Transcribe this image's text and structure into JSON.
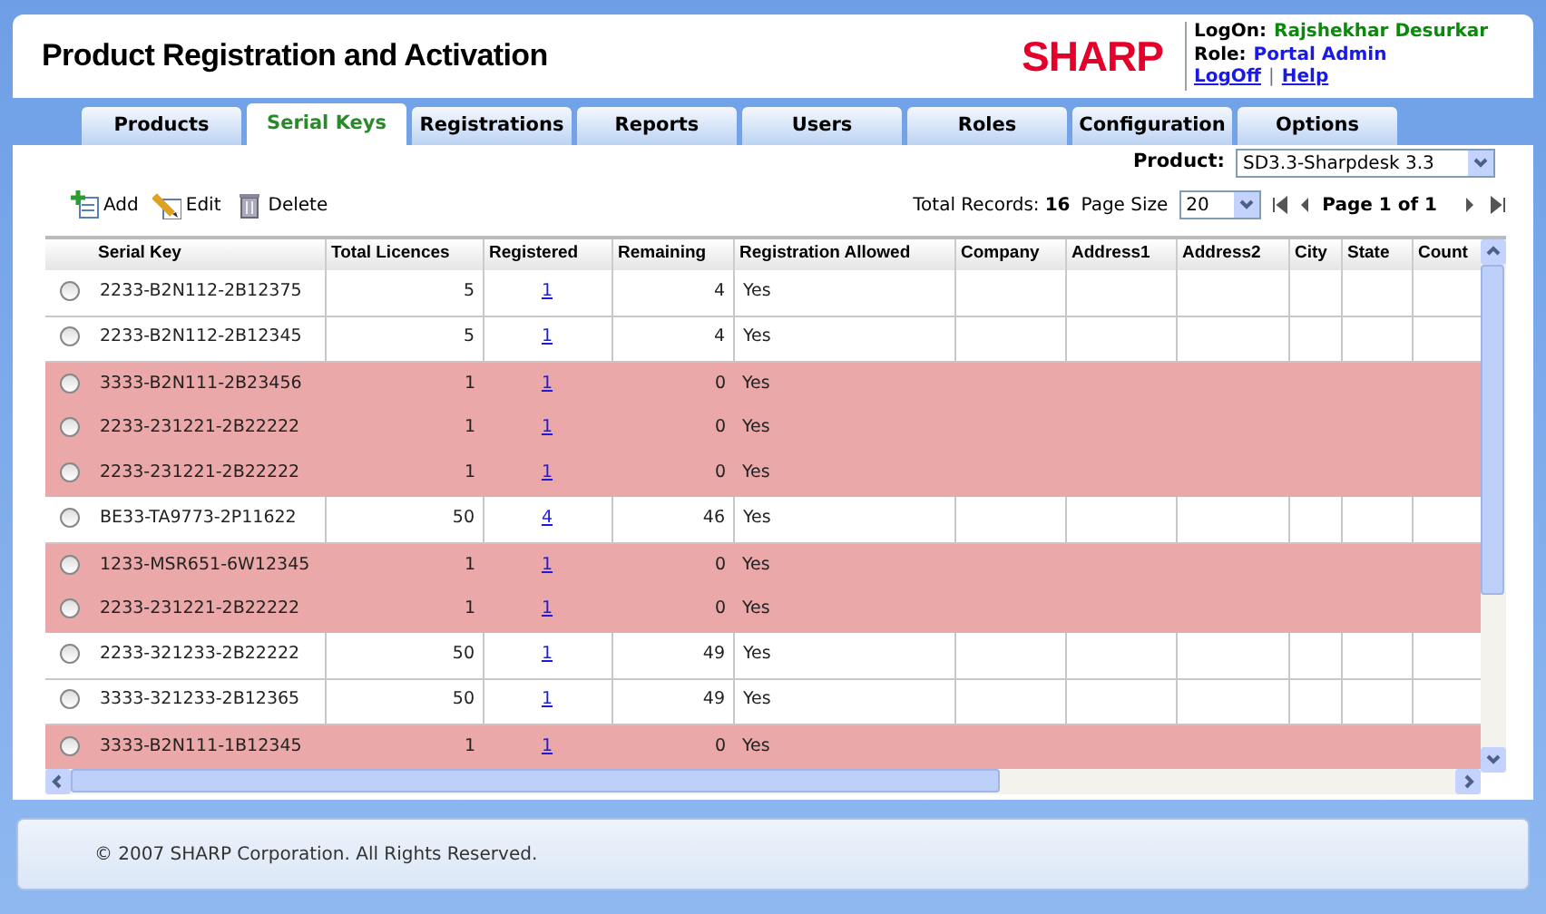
{
  "header": {
    "title": "Product Registration and Activation",
    "logo": "SHARP",
    "logon_label": "LogOn:",
    "logon_user": "Rajshekhar Desurkar",
    "role_label": "Role:",
    "role": "Portal Admin",
    "logoff": "LogOff",
    "separator": "|",
    "help": "Help"
  },
  "tabs": [
    {
      "label": "Products",
      "selected": false
    },
    {
      "label": "Serial Keys",
      "selected": true
    },
    {
      "label": "Registrations",
      "selected": false
    },
    {
      "label": "Reports",
      "selected": false
    },
    {
      "label": "Users",
      "selected": false
    },
    {
      "label": "Roles",
      "selected": false
    },
    {
      "label": "Configuration",
      "selected": false
    },
    {
      "label": "Options",
      "selected": false
    }
  ],
  "product": {
    "label": "Product:",
    "value": "SD3.3-Sharpdesk 3.3"
  },
  "toolbar": [
    {
      "kind": "add",
      "label": "Add"
    },
    {
      "kind": "edit",
      "label": "Edit"
    },
    {
      "kind": "delete",
      "label": "Delete"
    }
  ],
  "paging": {
    "total_label": "Total Records:",
    "total": "16",
    "page_size_label": "Page Size",
    "page_size": "20",
    "page_text": "Page",
    "page": "1",
    "of": "of",
    "pages": "1"
  },
  "table": {
    "columns": [
      "Serial Key",
      "Total Licences",
      "Registered",
      "Remaining",
      "Registration Allowed",
      "Company",
      "Address1",
      "Address2",
      "City",
      "State",
      "Count"
    ],
    "rows": [
      {
        "serial": "2233-B2N112-2B12375",
        "total": "5",
        "registered": "1",
        "remaining": "4",
        "allowed": "Yes",
        "highlighted": false,
        "selected": false
      },
      {
        "serial": "2233-B2N112-2B12345",
        "total": "5",
        "registered": "1",
        "remaining": "4",
        "allowed": "Yes",
        "highlighted": false,
        "selected": false
      },
      {
        "serial": "3333-B2N111-2B23456",
        "total": "1",
        "registered": "1",
        "remaining": "0",
        "allowed": "Yes",
        "highlighted": true,
        "selected": false
      },
      {
        "serial": "2233-231221-2B22222",
        "total": "1",
        "registered": "1",
        "remaining": "0",
        "allowed": "Yes",
        "highlighted": true,
        "selected": false
      },
      {
        "serial": "2233-231221-2B22222",
        "total": "1",
        "registered": "1",
        "remaining": "0",
        "allowed": "Yes",
        "highlighted": true,
        "selected": false
      },
      {
        "serial": "BE33-TA9773-2P11622",
        "total": "50",
        "registered": "4",
        "remaining": "46",
        "allowed": "Yes",
        "highlighted": false,
        "selected": false
      },
      {
        "serial": "1233-MSR651-6W12345",
        "total": "1",
        "registered": "1",
        "remaining": "0",
        "allowed": "Yes",
        "highlighted": true,
        "selected": false
      },
      {
        "serial": "2233-231221-2B22222",
        "total": "1",
        "registered": "1",
        "remaining": "0",
        "allowed": "Yes",
        "highlighted": true,
        "selected": false
      },
      {
        "serial": "2233-321233-2B22222",
        "total": "50",
        "registered": "1",
        "remaining": "49",
        "allowed": "Yes",
        "highlighted": false,
        "selected": false
      },
      {
        "serial": "3333-321233-2B12365",
        "total": "50",
        "registered": "1",
        "remaining": "49",
        "allowed": "Yes",
        "highlighted": false,
        "selected": false
      },
      {
        "serial": "3333-B2N111-1B12345",
        "total": "1",
        "registered": "1",
        "remaining": "0",
        "allowed": "Yes",
        "highlighted": true,
        "selected": false
      }
    ]
  },
  "footer": "© 2007 SHARP Corporation. All Rights Reserved."
}
